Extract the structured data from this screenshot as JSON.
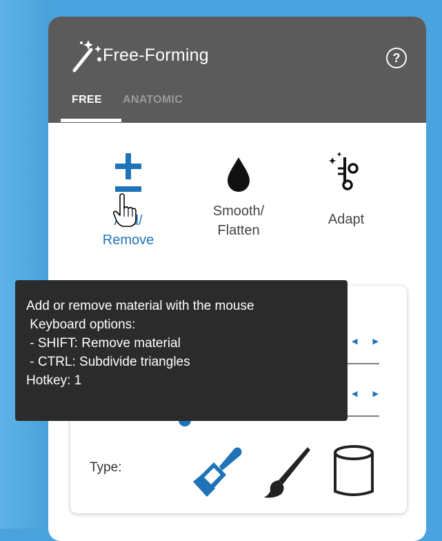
{
  "panel": {
    "title": "Free-Forming",
    "help_icon": "help-circle-icon",
    "title_icon": "magic-wand-icon",
    "tabs": [
      {
        "label": "FREE",
        "active": true
      },
      {
        "label": "ANATOMIC",
        "active": false
      }
    ]
  },
  "tools": [
    {
      "line1": "Add/",
      "line2": "Remove",
      "icon": "plus-minus-icon",
      "active": true
    },
    {
      "line1": "Smooth/",
      "line2": "Flatten",
      "icon": "drop-icon",
      "active": false
    },
    {
      "line1": "Adapt",
      "line2": "",
      "icon": "scissors-sparkle-icon",
      "active": false
    }
  ],
  "settings": {
    "type_label": "Type:",
    "type_options": [
      {
        "icon": "paint-brush-icon",
        "selected": true
      },
      {
        "icon": "thin-brush-icon",
        "selected": false
      },
      {
        "icon": "cylinder-icon",
        "selected": false
      }
    ]
  },
  "tooltip": {
    "lines": [
      "Add or remove material with the mouse",
      " Keyboard options:",
      " - SHIFT: Remove material",
      " - CTRL: Subdivide triangles",
      "Hotkey: 1"
    ]
  },
  "colors": {
    "accent": "#1f73b8",
    "header_bg": "#5b5b5b",
    "tooltip_bg": "#2b2b2b",
    "background": "#4aa3de"
  }
}
